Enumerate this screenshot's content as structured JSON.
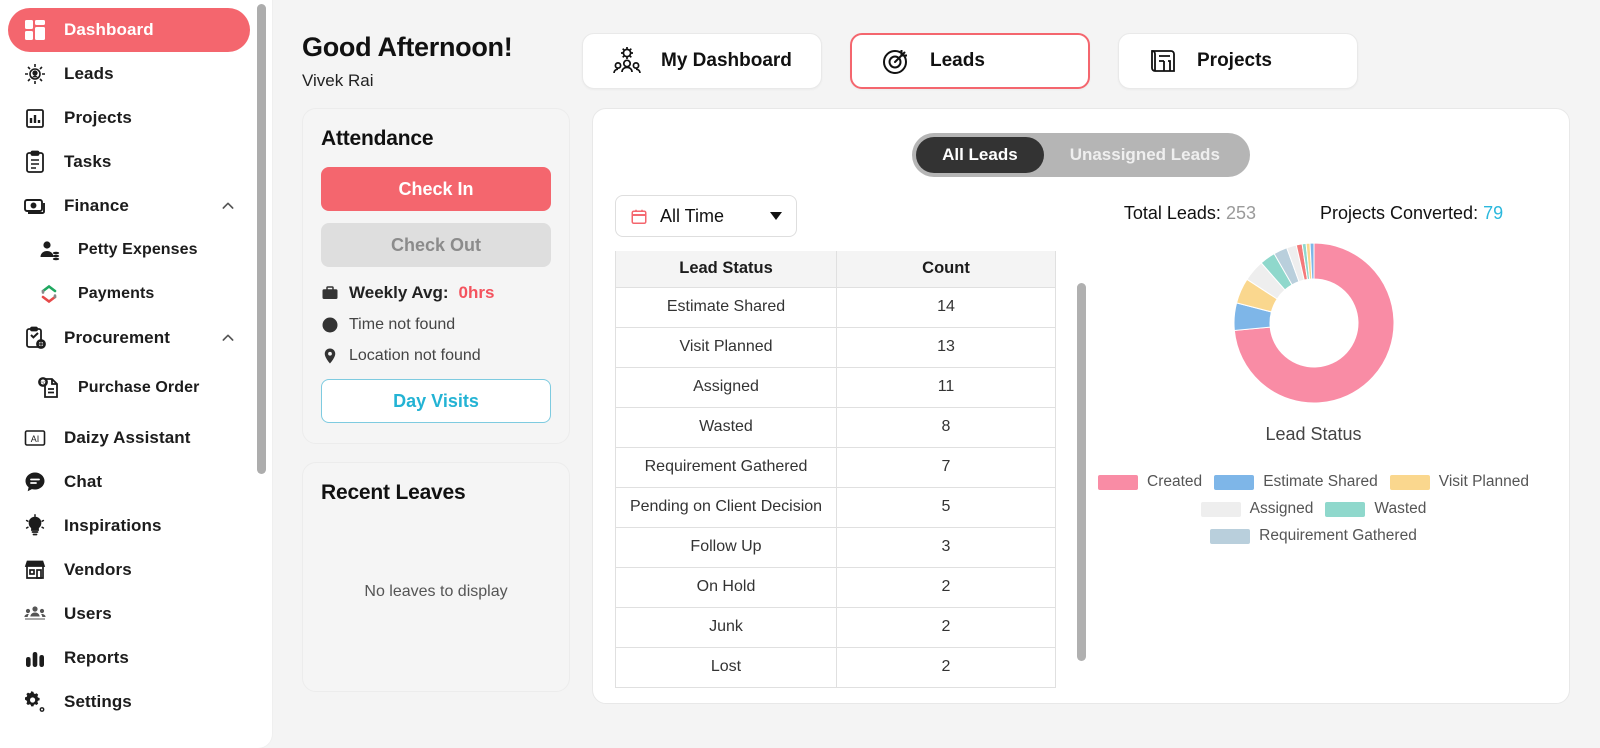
{
  "sidebar": {
    "items": [
      {
        "label": "Dashboard",
        "icon": "dashboard-icon",
        "active": true,
        "sub": false
      },
      {
        "label": "Leads",
        "icon": "leads-icon",
        "active": false,
        "sub": false
      },
      {
        "label": "Projects",
        "icon": "projects-icon",
        "active": false,
        "sub": false
      },
      {
        "label": "Tasks",
        "icon": "tasks-icon",
        "active": false,
        "sub": false
      },
      {
        "label": "Finance",
        "icon": "finance-icon",
        "active": false,
        "sub": false,
        "expandable": true
      },
      {
        "label": "Petty Expenses",
        "icon": "petty-expenses-icon",
        "active": false,
        "sub": true
      },
      {
        "label": "Payments",
        "icon": "payments-icon",
        "active": false,
        "sub": true
      },
      {
        "label": "Procurement",
        "icon": "procurement-icon",
        "active": false,
        "sub": false,
        "expandable": true
      },
      {
        "label": "Purchase Order",
        "icon": "purchase-order-icon",
        "active": false,
        "sub": true,
        "twoline": true
      },
      {
        "label": "Daizy Assistant",
        "icon": "ai-icon",
        "active": false,
        "sub": false
      },
      {
        "label": "Chat",
        "icon": "chat-icon",
        "active": false,
        "sub": false
      },
      {
        "label": "Inspirations",
        "icon": "inspirations-icon",
        "active": false,
        "sub": false
      },
      {
        "label": "Vendors",
        "icon": "vendors-icon",
        "active": false,
        "sub": false
      },
      {
        "label": "Users",
        "icon": "users-icon",
        "active": false,
        "sub": false
      },
      {
        "label": "Reports",
        "icon": "reports-icon",
        "active": false,
        "sub": false
      },
      {
        "label": "Settings",
        "icon": "settings-icon",
        "active": false,
        "sub": false
      }
    ]
  },
  "header": {
    "greeting": "Good Afternoon!",
    "user_name": "Vivek Rai",
    "tabs": [
      {
        "label": "My Dashboard",
        "icon": "team-dashboard-icon",
        "active": false
      },
      {
        "label": "Leads",
        "icon": "target-icon",
        "active": true
      },
      {
        "label": "Projects",
        "icon": "blueprint-icon",
        "active": false
      }
    ]
  },
  "attendance": {
    "title": "Attendance",
    "check_in_label": "Check In",
    "check_out_label": "Check Out",
    "weekly_avg_label": "Weekly Avg:",
    "weekly_avg_value": "0hrs",
    "time_text": "Time not found",
    "location_text": "Location not found",
    "day_visits_label": "Day Visits"
  },
  "recent_leaves": {
    "title": "Recent Leaves",
    "empty_text": "No leaves to display"
  },
  "leads_panel": {
    "toggle": [
      {
        "label": "All Leads",
        "selected": true
      },
      {
        "label": "Unassigned Leads",
        "selected": false
      }
    ],
    "filter_value": "All Time",
    "total_leads_label": "Total Leads:",
    "total_leads_value": "253",
    "projects_converted_label": "Projects Converted:",
    "projects_converted_value": "79",
    "table": {
      "columns": [
        "Lead Status",
        "Count"
      ],
      "rows": [
        [
          "Estimate Shared",
          "14"
        ],
        [
          "Visit Planned",
          "13"
        ],
        [
          "Assigned",
          "11"
        ],
        [
          "Wasted",
          "8"
        ],
        [
          "Requirement Gathered",
          "7"
        ],
        [
          "Pending on Client Decision",
          "5"
        ],
        [
          "Follow Up",
          "3"
        ],
        [
          "On Hold",
          "2"
        ],
        [
          "Junk",
          "2"
        ],
        [
          "Lost",
          "2"
        ]
      ]
    }
  },
  "chart_data": {
    "type": "pie",
    "title": "Lead Status",
    "legend_position": "bottom",
    "categories": [
      "Created",
      "Estimate Shared",
      "Visit Planned",
      "Assigned",
      "Wasted",
      "Requirement Gathered",
      "Pending on Client Decision",
      "Follow Up",
      "On Hold",
      "Junk",
      "Lost"
    ],
    "values": [
      186,
      14,
      13,
      11,
      8,
      7,
      5,
      3,
      2,
      2,
      2
    ],
    "colors": [
      "#f98ca5",
      "#7eb6e8",
      "#fad78e",
      "#eeeeee",
      "#8fd8cc",
      "#b9cfdc",
      "#eeeeee",
      "#f47a7a",
      "#8fd8cc",
      "#fad78e",
      "#7eb6e8"
    ],
    "legend_entries": [
      {
        "label": "Created",
        "color": "#f98ca5"
      },
      {
        "label": "Estimate Shared",
        "color": "#7eb6e8"
      },
      {
        "label": "Visit Planned",
        "color": "#fad78e"
      },
      {
        "label": "Assigned",
        "color": "#eeeeee"
      },
      {
        "label": "Wasted",
        "color": "#8fd8cc"
      },
      {
        "label": "Requirement Gathered",
        "color": "#b9cfdc"
      }
    ]
  },
  "theme": {
    "accent_red": "#f4666e",
    "accent_blue": "#23b3d4",
    "sidebar_bg": "#ffffff",
    "page_bg": "#f4f4f4"
  }
}
